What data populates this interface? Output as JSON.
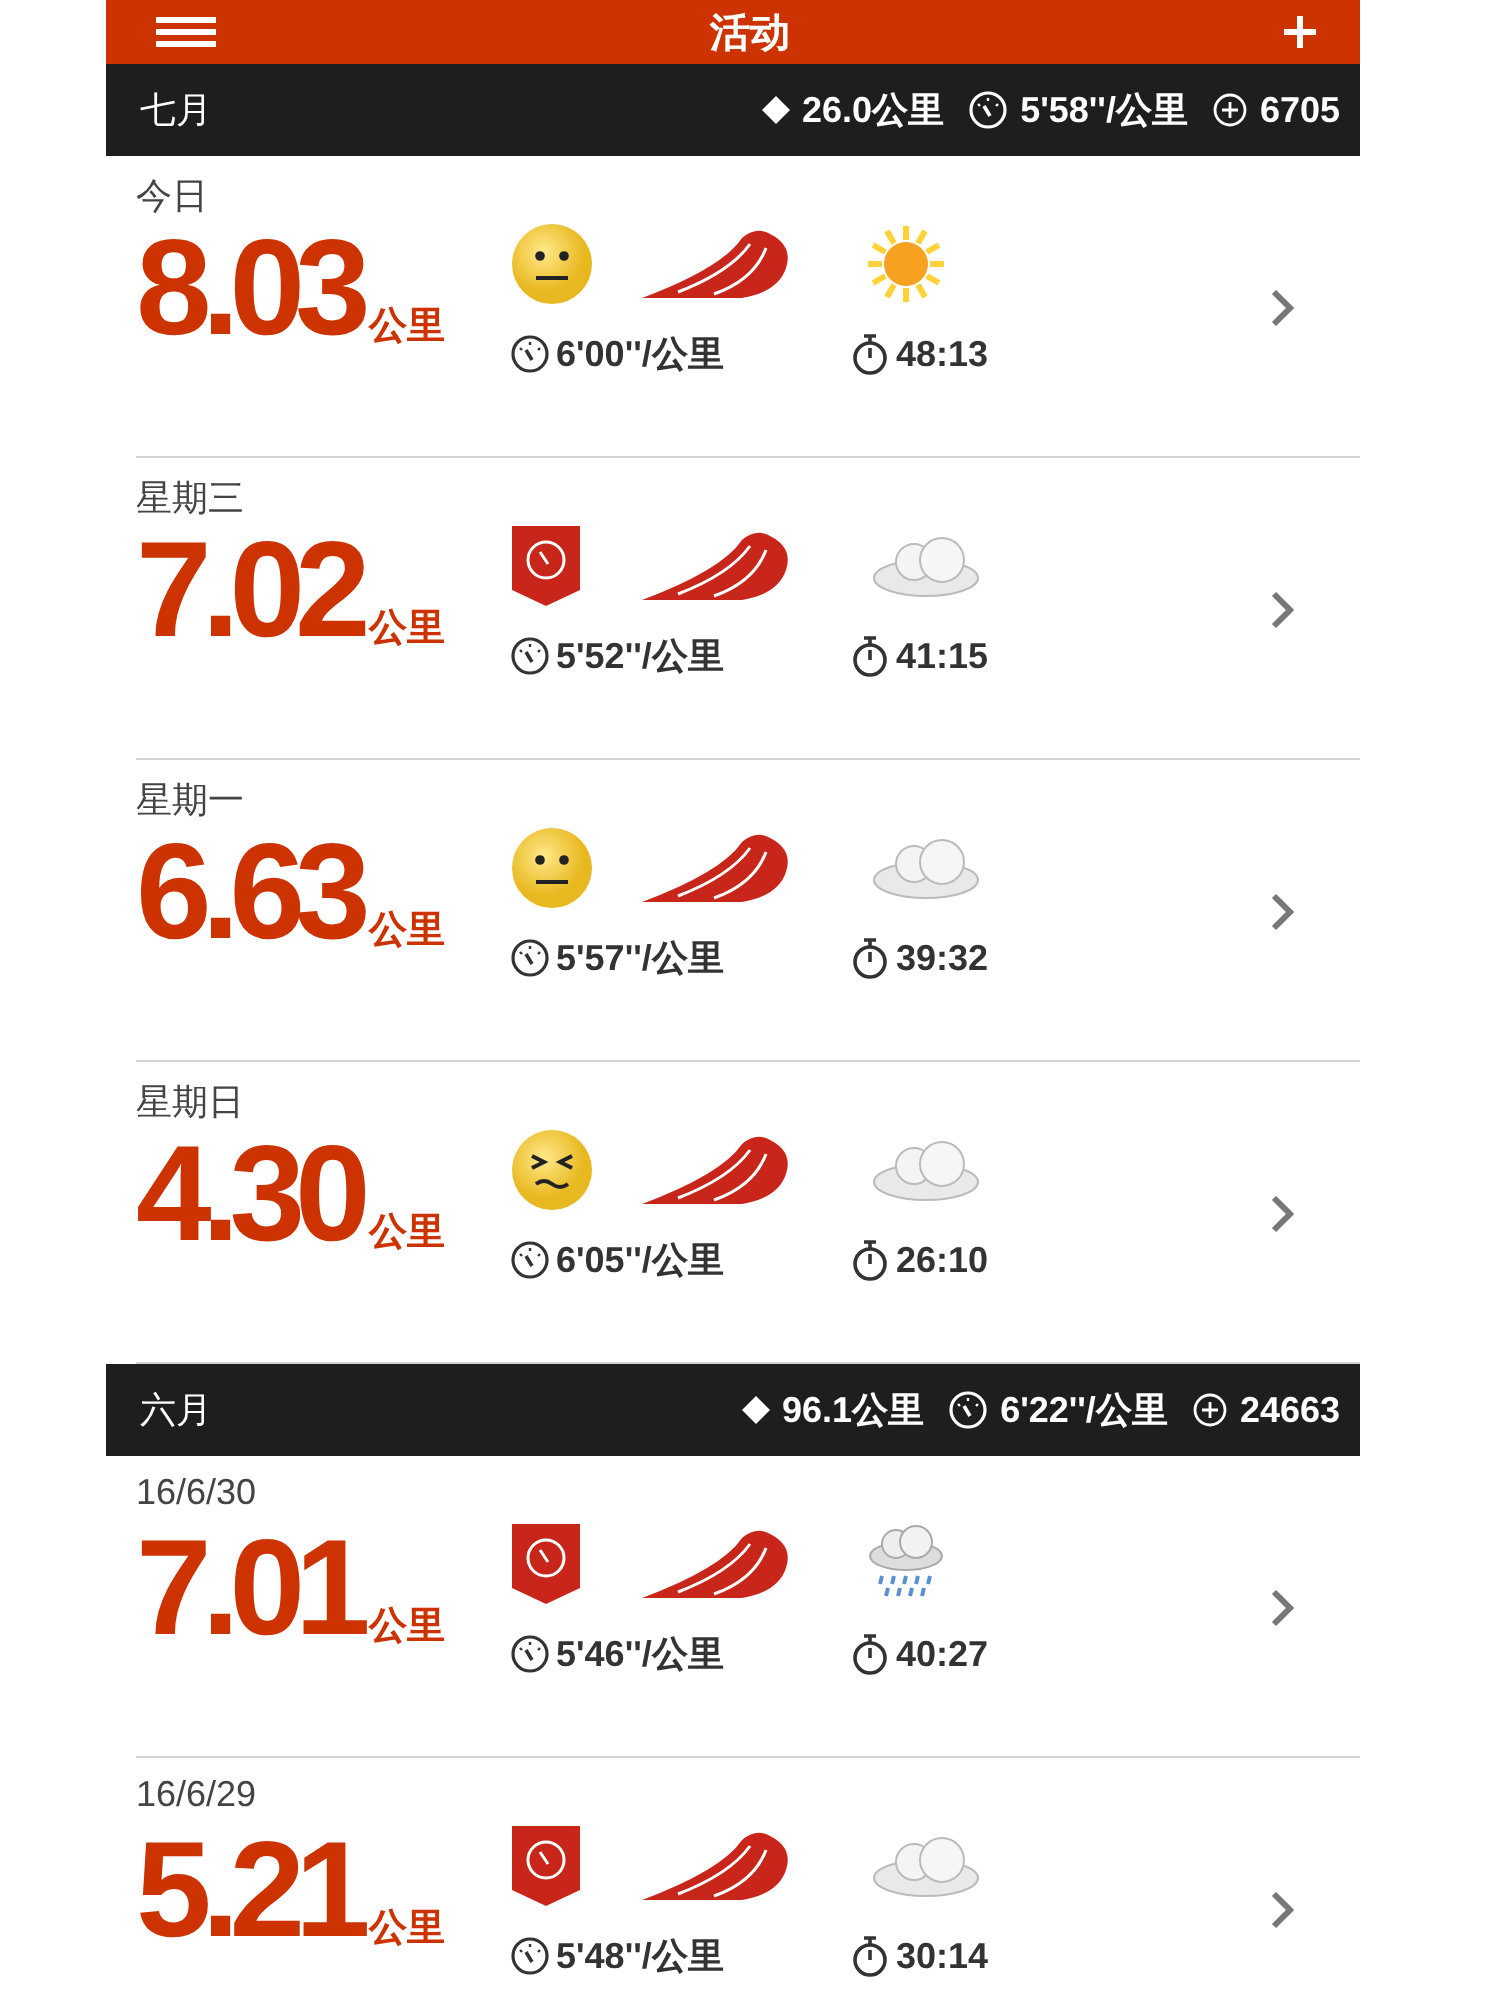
{
  "header": {
    "title": "活动"
  },
  "months": [
    {
      "name": "七月",
      "distance": "26.0公里",
      "pace": "5'58''/公里",
      "fuel": "6705",
      "runs": [
        {
          "date": "今日",
          "distance": "8.03",
          "unit": "公里",
          "icons": [
            {
              "kind": "neutral"
            },
            {
              "kind": "track"
            },
            {
              "kind": "sunny"
            }
          ],
          "pace": "6'00''/公里",
          "duration": "48:13"
        },
        {
          "date": "星期三",
          "distance": "7.02",
          "unit": "公里",
          "icons": [
            {
              "kind": "badge"
            },
            {
              "kind": "track"
            },
            {
              "kind": "cloudy"
            }
          ],
          "pace": "5'52''/公里",
          "duration": "41:15"
        },
        {
          "date": "星期一",
          "distance": "6.63",
          "unit": "公里",
          "icons": [
            {
              "kind": "neutral"
            },
            {
              "kind": "track"
            },
            {
              "kind": "cloudy"
            }
          ],
          "pace": "5'57''/公里",
          "duration": "39:32"
        },
        {
          "date": "星期日",
          "distance": "4.30",
          "unit": "公里",
          "icons": [
            {
              "kind": "strained"
            },
            {
              "kind": "track"
            },
            {
              "kind": "cloudy"
            }
          ],
          "pace": "6'05''/公里",
          "duration": "26:10"
        }
      ]
    },
    {
      "name": "六月",
      "distance": "96.1公里",
      "pace": "6'22''/公里",
      "fuel": "24663",
      "runs": [
        {
          "date": "16/6/30",
          "distance": "7.01",
          "unit": "公里",
          "icons": [
            {
              "kind": "badge"
            },
            {
              "kind": "track"
            },
            {
              "kind": "rain"
            }
          ],
          "pace": "5'46''/公里",
          "duration": "40:27"
        },
        {
          "date": "16/6/29",
          "distance": "5.21",
          "unit": "公里",
          "icons": [
            {
              "kind": "badge"
            },
            {
              "kind": "track"
            },
            {
              "kind": "cloudy"
            }
          ],
          "pace": "5'48''/公里",
          "duration": "30:14"
        }
      ]
    }
  ]
}
